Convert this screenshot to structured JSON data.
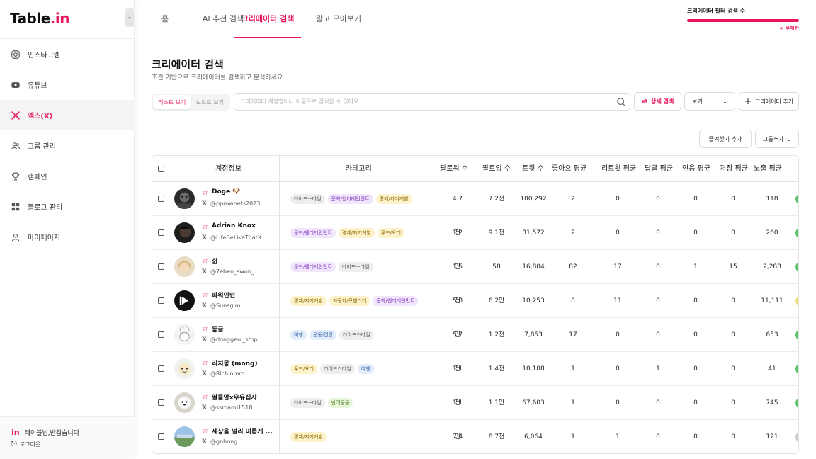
{
  "app": {
    "logo_main": "Table",
    "logo_dot": ".",
    "logo_tail": "in"
  },
  "sidebar": {
    "items": [
      {
        "label": "인스타그램",
        "icon": "instagram-icon"
      },
      {
        "label": "유튜브",
        "icon": "youtube-icon"
      },
      {
        "label": "엑스(X)",
        "icon": "x-icon",
        "active": true
      },
      {
        "label": "그룹 관리",
        "icon": "users-icon"
      },
      {
        "label": "캠페인",
        "icon": "trophy-icon"
      },
      {
        "label": "블로그 관리",
        "icon": "grid-icon"
      },
      {
        "label": "마이페이지",
        "icon": "user-icon"
      }
    ],
    "greeting_brand": "in",
    "greeting": "테이블님,반갑습니다",
    "logout": "로그아웃"
  },
  "tabs": [
    {
      "label": "홈"
    },
    {
      "label": "AI 추천 검색"
    },
    {
      "label": "크리에이터 검색",
      "active": true
    },
    {
      "label": "광고 모아보기"
    }
  ],
  "quota": {
    "label": "크리에이터 필터 검색 수",
    "value_text": "∞ 무제한",
    "fill": 1.0,
    "color": "#e8175d"
  },
  "header": {
    "title": "크리에이터 검색",
    "subtitle": "조건 기반으로 크리에이터를 검색하고 분석하세요."
  },
  "toolbar": {
    "list_view": "리스트 보기",
    "board_view": "보드로 보기",
    "search_placeholder": "크리에이터 계정명이나 이름으로 검색할 수 있어요",
    "detail_search": "상세 검색",
    "view": "보기",
    "add_creator": "크리에이터 추가",
    "favorites_add": "즐겨찾기 추가",
    "group_add": "그룹추가"
  },
  "table": {
    "columns": [
      "계정정보",
      "카테고리",
      "팔로워 수",
      "팔로잉 수",
      "트윗 수",
      "좋아요 평균",
      "리트윗 평균",
      "답글 평균",
      "인용 평균",
      "저장 평균",
      "노출 평균"
    ],
    "rows": [
      {
        "name": "Doge 🐶",
        "handle": "@pprownets2023",
        "tags": [
          [
            "라이프스타일",
            "gray"
          ],
          [
            "문화/엔터테인먼트",
            "purple"
          ],
          [
            "경제/자기계발",
            "yellow"
          ]
        ],
        "followers": "4.7천",
        "following": "7.2천",
        "tweets": "100,292",
        "likes": "2",
        "retweets": "0",
        "replies": "0",
        "quotes": "0",
        "saves": "0",
        "views": "118",
        "pill": "#5cc26a"
      },
      {
        "name": "Adrian Knox",
        "handle": "@LifeBeLikeThatX",
        "tags": [
          [
            "문화/엔터테인먼트",
            "purple"
          ],
          [
            "경제/자기계발",
            "yellow"
          ],
          [
            "푸드/요리",
            "yellow"
          ]
        ],
        "followers": "1.2만",
        "following": "9.1천",
        "tweets": "81,572",
        "likes": "2",
        "retweets": "0",
        "replies": "0",
        "quotes": "0",
        "saves": "0",
        "views": "260",
        "pill": "#5cc26a"
      },
      {
        "name": "쉰",
        "handle": "@7eben_swon_",
        "tags": [
          [
            "문화/엔터테인먼트",
            "purple"
          ],
          [
            "라이프스타일",
            "gray"
          ]
        ],
        "followers": "1.5천",
        "following": "58",
        "tweets": "16,804",
        "likes": "82",
        "retweets": "17",
        "replies": "0",
        "quotes": "1",
        "saves": "15",
        "views": "2,288",
        "pill": "#5cc26a"
      },
      {
        "name": "파워민턴",
        "handle": "@Sunsgim",
        "tags": [
          [
            "경제/자기계발",
            "yellow"
          ],
          [
            "자동차/모빌리티",
            "yellow"
          ],
          [
            "문화/엔터테인먼트",
            "purple"
          ]
        ],
        "followers": "5.8만",
        "following": "6.2만",
        "tweets": "10,253",
        "likes": "8",
        "retweets": "11",
        "replies": "0",
        "quotes": "0",
        "saves": "0",
        "views": "11,111",
        "pill": "#f2e27a"
      },
      {
        "name": "동글",
        "handle": "@donggeul_stop",
        "tags": [
          [
            "여행",
            "blue"
          ],
          [
            "운동/건강",
            "blue"
          ],
          [
            "라이프스타일",
            "gray"
          ]
        ],
        "followers": "5.7천",
        "following": "1.2천",
        "tweets": "7,853",
        "likes": "17",
        "retweets": "0",
        "replies": "0",
        "quotes": "0",
        "saves": "0",
        "views": "653",
        "pill": "#5cc26a"
      },
      {
        "name": "리치몽 (mong)",
        "handle": "@Richinmm",
        "tags": [
          [
            "푸드/요리",
            "yellow"
          ],
          [
            "라이프스타일",
            "gray"
          ],
          [
            "여행",
            "blue"
          ]
        ],
        "followers": "1.1천",
        "following": "1.4천",
        "tweets": "10,108",
        "likes": "1",
        "retweets": "0",
        "replies": "1",
        "quotes": "0",
        "saves": "0",
        "views": "41",
        "pill": "#5cc26a"
      },
      {
        "name": "딸둘맘x우유집사",
        "handle": "@ssmami1518",
        "tags": [
          [
            "라이프스타일",
            "gray"
          ],
          [
            "반려동물",
            "green"
          ]
        ],
        "followers": "1.1만",
        "following": "1.1만",
        "tweets": "67,603",
        "likes": "1",
        "retweets": "0",
        "replies": "0",
        "quotes": "0",
        "saves": "0",
        "views": "745",
        "pill": "#5cc26a"
      },
      {
        "name": "세상을 널리 이롭게 ...",
        "handle": "@gnhong",
        "tags": [
          [
            "경제/자기계발",
            "yellow"
          ]
        ],
        "followers": "7.4천",
        "following": "8.7천",
        "tweets": "6,064",
        "likes": "1",
        "retweets": "1",
        "replies": "0",
        "quotes": "0",
        "saves": "0",
        "views": "121",
        "pill": "#c9c9c9"
      }
    ]
  }
}
